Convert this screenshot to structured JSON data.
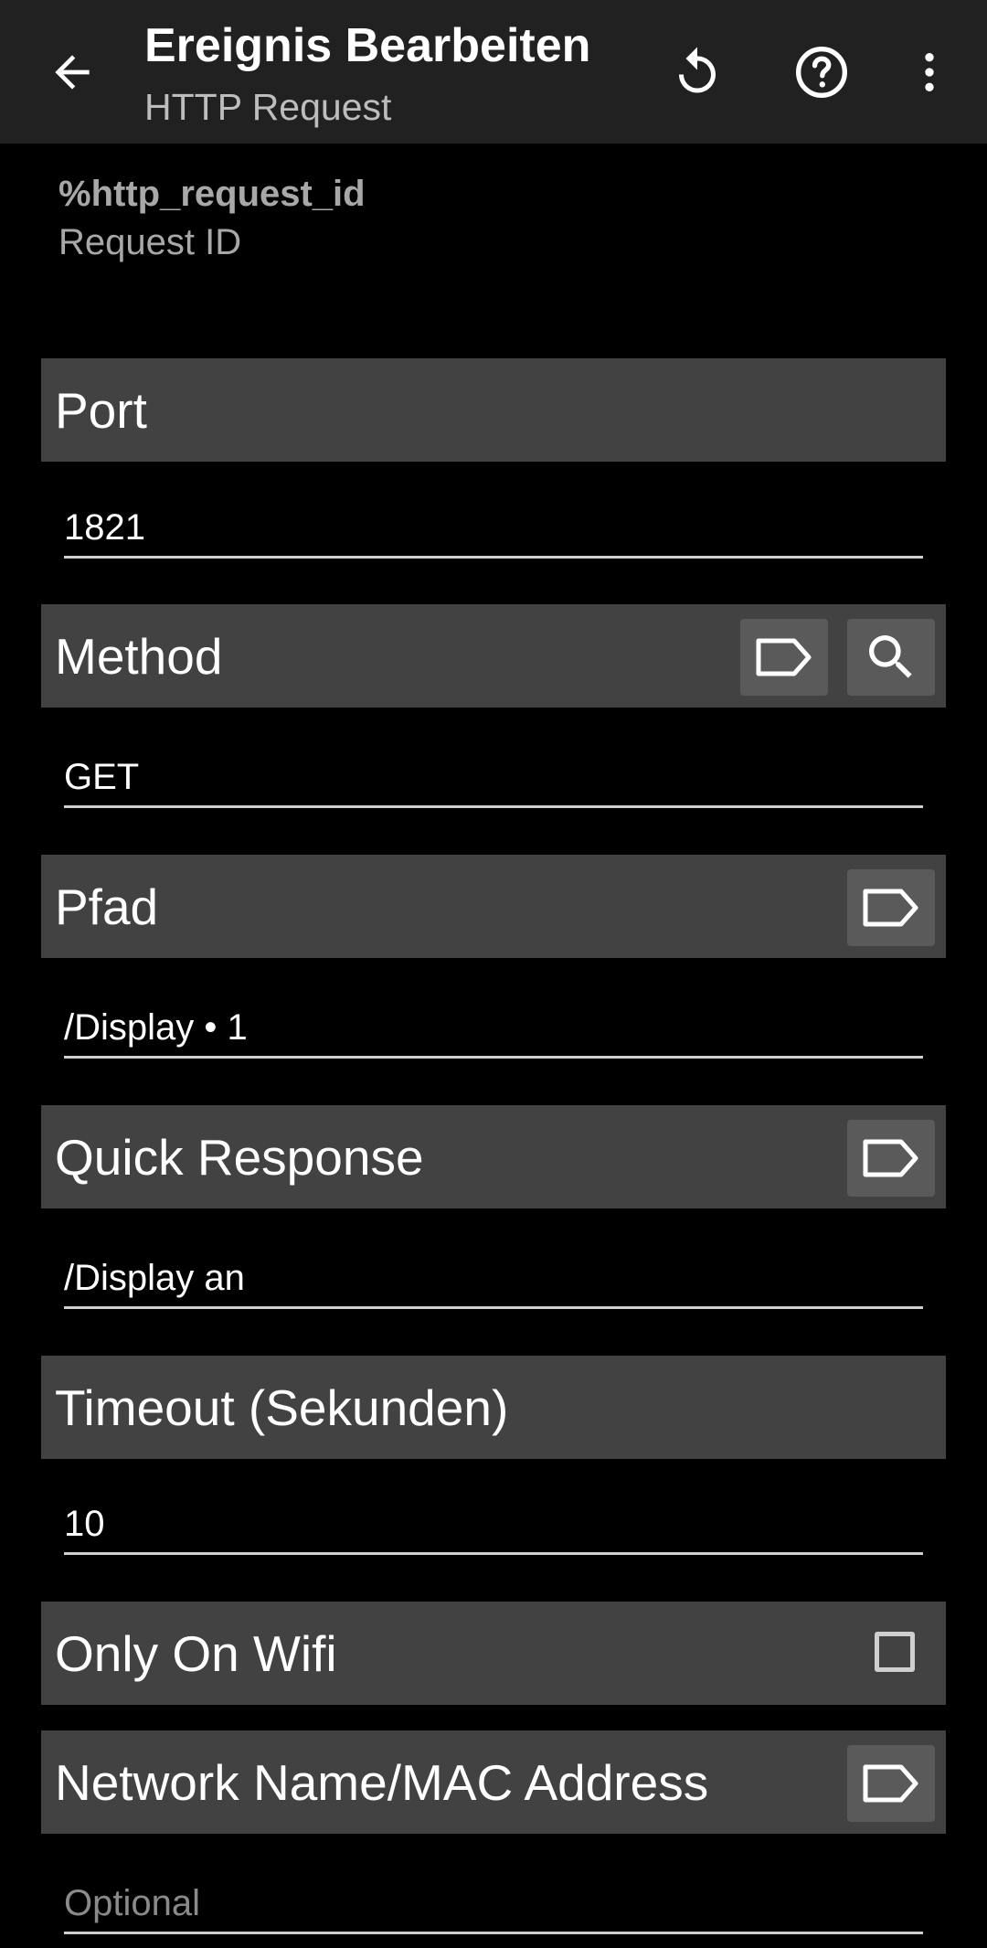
{
  "appbar": {
    "title": "Ereignis Bearbeiten",
    "subtitle": "HTTP Request",
    "back_icon": "arrow-back-icon",
    "actions": [
      "reset-icon",
      "help-icon",
      "more-vert-icon"
    ]
  },
  "info": {
    "variable": "%http_request_id",
    "description": "Request ID"
  },
  "sections": {
    "port": {
      "label": "Port",
      "value": "1821"
    },
    "method": {
      "label": "Method",
      "value": "GET"
    },
    "pfad": {
      "label": "Pfad",
      "value": "/Display • 1"
    },
    "quick_response": {
      "label": "Quick Response",
      "value": "/Display an"
    },
    "timeout": {
      "label": "Timeout (Sekunden)",
      "value": "10"
    },
    "only_on_wifi": {
      "label": "Only On Wifi",
      "checked": false
    },
    "network": {
      "label": "Network Name/MAC Address",
      "placeholder": "Optional"
    }
  },
  "colors": {
    "appbar": "#212121",
    "background": "#000000",
    "section": "#424242",
    "button": "#5a5a5a"
  }
}
